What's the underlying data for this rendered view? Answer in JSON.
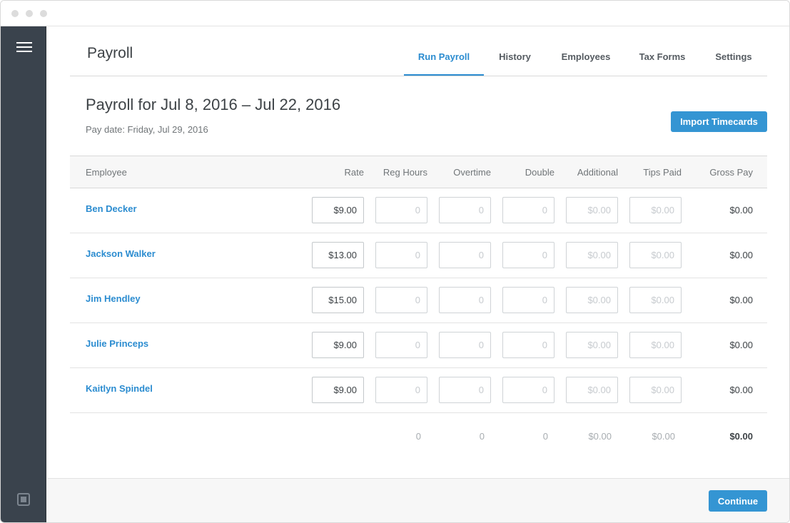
{
  "app": {
    "title": "Payroll"
  },
  "nav": {
    "tabs": [
      {
        "label": "Run Payroll",
        "active": true
      },
      {
        "label": "History",
        "active": false
      },
      {
        "label": "Employees",
        "active": false
      },
      {
        "label": "Tax Forms",
        "active": false
      },
      {
        "label": "Settings",
        "active": false
      }
    ]
  },
  "page": {
    "heading": "Payroll for Jul 8, 2016 – Jul 22, 2016",
    "pay_date": "Pay date: Friday, Jul 29, 2016",
    "import_button": "Import Timecards"
  },
  "table": {
    "columns": [
      "Employee",
      "Rate",
      "Reg Hours",
      "Overtime",
      "Double",
      "Additional",
      "Tips Paid",
      "Gross Pay"
    ],
    "rows": [
      {
        "employee": "Ben Decker",
        "rate": "$9.00",
        "reg_hours": "0",
        "overtime": "0",
        "double": "0",
        "additional": "$0.00",
        "tips_paid": "$0.00",
        "gross_pay": "$0.00"
      },
      {
        "employee": "Jackson Walker",
        "rate": "$13.00",
        "reg_hours": "0",
        "overtime": "0",
        "double": "0",
        "additional": "$0.00",
        "tips_paid": "$0.00",
        "gross_pay": "$0.00"
      },
      {
        "employee": "Jim Hendley",
        "rate": "$15.00",
        "reg_hours": "0",
        "overtime": "0",
        "double": "0",
        "additional": "$0.00",
        "tips_paid": "$0.00",
        "gross_pay": "$0.00"
      },
      {
        "employee": "Julie Princeps",
        "rate": "$9.00",
        "reg_hours": "0",
        "overtime": "0",
        "double": "0",
        "additional": "$0.00",
        "tips_paid": "$0.00",
        "gross_pay": "$0.00"
      },
      {
        "employee": "Kaitlyn Spindel",
        "rate": "$9.00",
        "reg_hours": "0",
        "overtime": "0",
        "double": "0",
        "additional": "$0.00",
        "tips_paid": "$0.00",
        "gross_pay": "$0.00"
      }
    ],
    "totals": {
      "reg_hours": "0",
      "overtime": "0",
      "double": "0",
      "additional": "$0.00",
      "tips_paid": "$0.00",
      "gross_pay": "$0.00"
    }
  },
  "footer": {
    "continue_button": "Continue"
  },
  "icons": {
    "menu": "hamburger-menu-icon",
    "brand": "square-logo-icon"
  },
  "colors": {
    "accent": "#2b8cd0",
    "button": "#3495d3",
    "sidebar": "#3a434d"
  }
}
